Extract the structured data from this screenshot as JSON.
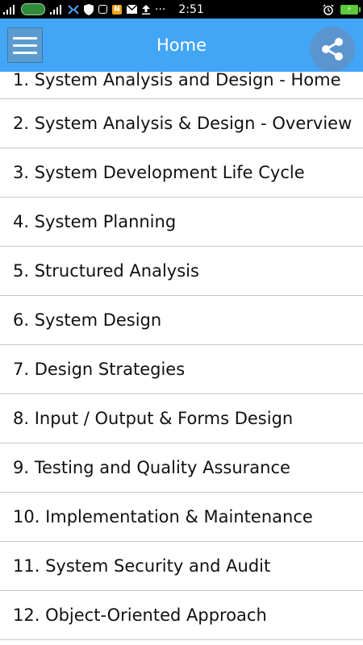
{
  "status_bar": {
    "time": "2:51",
    "dots": "···",
    "battery_symbol": "⚡"
  },
  "app_bar": {
    "title": "Home"
  },
  "topics": [
    "1. System Analysis and Design - Home",
    "2. System Analysis & Design - Overview",
    "3. System Development Life Cycle",
    "4. System Planning",
    "5. Structured Analysis",
    "6. System Design",
    "7. Design Strategies",
    "8. Input / Output & Forms Design",
    "9. Testing and Quality Assurance",
    "10. Implementation & Maintenance",
    "11. System Security and Audit",
    "12. Object-Oriented Approach"
  ],
  "colors": {
    "app_bar": "#42a5f5",
    "status_bar": "#000000",
    "divider": "#c8c8c8"
  },
  "icons": {
    "menu": "hamburger-menu-icon",
    "share": "share-icon"
  }
}
